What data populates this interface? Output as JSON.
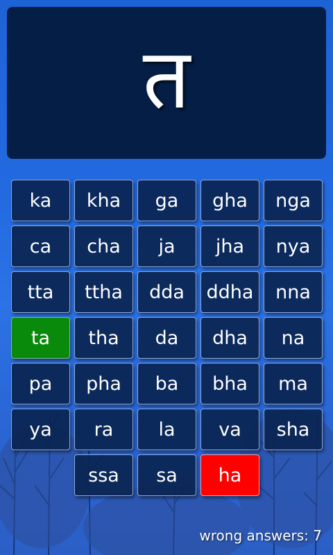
{
  "prompt": {
    "glyph": "त"
  },
  "keys": [
    {
      "label": "ka",
      "state": "normal"
    },
    {
      "label": "kha",
      "state": "normal"
    },
    {
      "label": "ga",
      "state": "normal"
    },
    {
      "label": "gha",
      "state": "normal"
    },
    {
      "label": "nga",
      "state": "normal"
    },
    {
      "label": "ca",
      "state": "normal"
    },
    {
      "label": "cha",
      "state": "normal"
    },
    {
      "label": "ja",
      "state": "normal"
    },
    {
      "label": "jha",
      "state": "normal"
    },
    {
      "label": "nya",
      "state": "normal"
    },
    {
      "label": "tta",
      "state": "normal"
    },
    {
      "label": "ttha",
      "state": "normal"
    },
    {
      "label": "dda",
      "state": "normal"
    },
    {
      "label": "ddha",
      "state": "normal"
    },
    {
      "label": "nna",
      "state": "normal"
    },
    {
      "label": "ta",
      "state": "correct"
    },
    {
      "label": "tha",
      "state": "normal"
    },
    {
      "label": "da",
      "state": "normal"
    },
    {
      "label": "dha",
      "state": "normal"
    },
    {
      "label": "na",
      "state": "normal"
    },
    {
      "label": "pa",
      "state": "normal"
    },
    {
      "label": "pha",
      "state": "normal"
    },
    {
      "label": "ba",
      "state": "normal"
    },
    {
      "label": "bha",
      "state": "normal"
    },
    {
      "label": "ma",
      "state": "normal"
    },
    {
      "label": "ya",
      "state": "normal"
    },
    {
      "label": "ra",
      "state": "normal"
    },
    {
      "label": "la",
      "state": "normal"
    },
    {
      "label": "va",
      "state": "normal"
    },
    {
      "label": "sha",
      "state": "normal"
    },
    {
      "label": "ssa",
      "state": "normal"
    },
    {
      "label": "sa",
      "state": "normal"
    },
    {
      "label": "ha",
      "state": "wrong"
    }
  ],
  "status": {
    "wrong_answers": "wrong answers: 7"
  },
  "colors": {
    "display_bg": "#041e45",
    "key_bg": "#0a2450",
    "correct": "#0a8a0a",
    "wrong": "#ff0000"
  }
}
